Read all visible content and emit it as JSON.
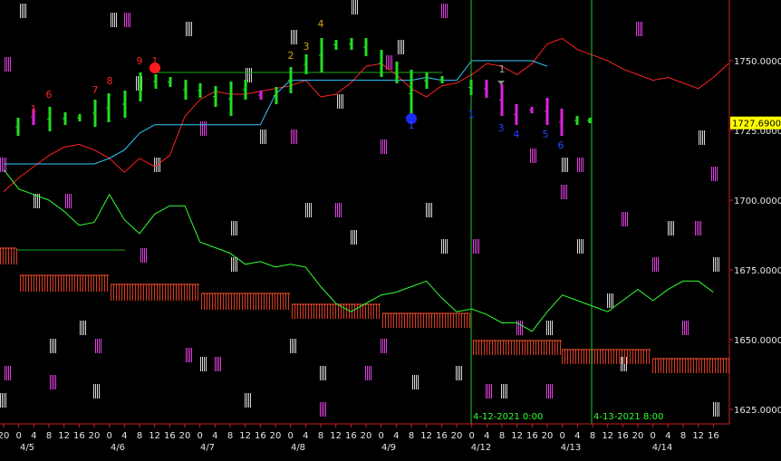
{
  "chart_data": {
    "type": "line",
    "title": "",
    "x_hours": [
      "20",
      "0",
      "4",
      "8",
      "12",
      "16",
      "20",
      "0",
      "4",
      "8",
      "12",
      "16",
      "20",
      "0",
      "4",
      "8",
      "12",
      "16",
      "20",
      "0",
      "4",
      "8",
      "12",
      "16",
      "20",
      "0",
      "4",
      "8",
      "12",
      "16",
      "20",
      "0",
      "4",
      "8",
      "12",
      "16",
      "20",
      "0",
      "4",
      "8",
      "12",
      "16",
      "20",
      "0",
      "4",
      "8",
      "12",
      "16"
    ],
    "x_dates": [
      "4/5",
      "4/6",
      "4/7",
      "4/8",
      "4/9",
      "4/12",
      "4/13",
      "4/14"
    ],
    "y_ticks": [
      "1750.00000",
      "1725.00000",
      "1700.00000",
      "1675.00000",
      "1650.00000",
      "1625.00000"
    ],
    "ylim": [
      1622,
      1766
    ],
    "current_price_label": "1727.69000",
    "current_price": 1727.69,
    "vlines": [
      {
        "label": "4-12-2021 0:00"
      },
      {
        "label": "4-13-2021 8:00"
      }
    ],
    "series": [
      {
        "name": "",
        "color": "#ff2222",
        "values": [
          1703,
          1708,
          1712,
          1716,
          1719,
          1720,
          1718,
          1715,
          1710,
          1715,
          1712,
          1716,
          1730,
          1736,
          1739,
          1738,
          1738,
          1739,
          1740,
          1741,
          1743,
          1737,
          1738,
          1742,
          1748,
          1749,
          1745,
          1740,
          1737,
          1741,
          1742,
          1745,
          1749,
          1748,
          1745,
          1749,
          1756,
          1758,
          1754,
          1752,
          1750,
          1747,
          1745,
          1743,
          1744,
          1742,
          1740,
          1744,
          1749
        ]
      },
      {
        "name": "",
        "color": "#33ccff",
        "values": [
          1713,
          1713,
          1713,
          1713,
          1713,
          1713,
          1713,
          1715,
          1718,
          1724,
          1727,
          1727,
          1727,
          1727,
          1727,
          1727,
          1727,
          1727,
          1738,
          1743,
          1743,
          1743,
          1743,
          1743,
          1743,
          1743,
          1743,
          1743,
          1744,
          1743,
          1743,
          1750,
          1750,
          1750,
          1750,
          1750,
          1748
        ]
      },
      {
        "name": "",
        "color": "#33ff33",
        "values": [
          1711,
          1704,
          1702,
          1700,
          1696,
          1691,
          1692,
          1702,
          1693,
          1688,
          1695,
          1698,
          1698,
          1685,
          1683,
          1681,
          1677,
          1678,
          1676,
          1677,
          1676,
          1669,
          1663,
          1660,
          1663,
          1666,
          1667,
          1669,
          1671,
          1665,
          1660,
          1661,
          1659,
          1656,
          1656,
          1653,
          1660,
          1666,
          1664,
          1662,
          1660,
          1664,
          1668,
          1664,
          1668,
          1671,
          1671,
          1667
        ]
      }
    ],
    "annotations": [
      {
        "text": "1",
        "color": "#ff2222"
      },
      {
        "text": "6",
        "color": "#ff2222"
      },
      {
        "text": "7",
        "color": "#ff2222"
      },
      {
        "text": "8",
        "color": "#ff2222"
      },
      {
        "text": "9",
        "color": "#ff2222"
      },
      {
        "text": "1",
        "color": "#ff2222"
      },
      {
        "text": "2",
        "color": "#d4a017"
      },
      {
        "text": "3",
        "color": "#d4a017"
      },
      {
        "text": "4",
        "color": "#d4a017"
      },
      {
        "text": "1",
        "color": "#2244ff"
      },
      {
        "text": "1",
        "color": "#2244ff"
      },
      {
        "text": "1",
        "color": "#aaaaaa"
      },
      {
        "text": "3",
        "color": "#2244ff"
      },
      {
        "text": "4",
        "color": "#2244ff"
      },
      {
        "text": "5",
        "color": "#2244ff"
      },
      {
        "text": "6",
        "color": "#2244ff"
      }
    ]
  }
}
